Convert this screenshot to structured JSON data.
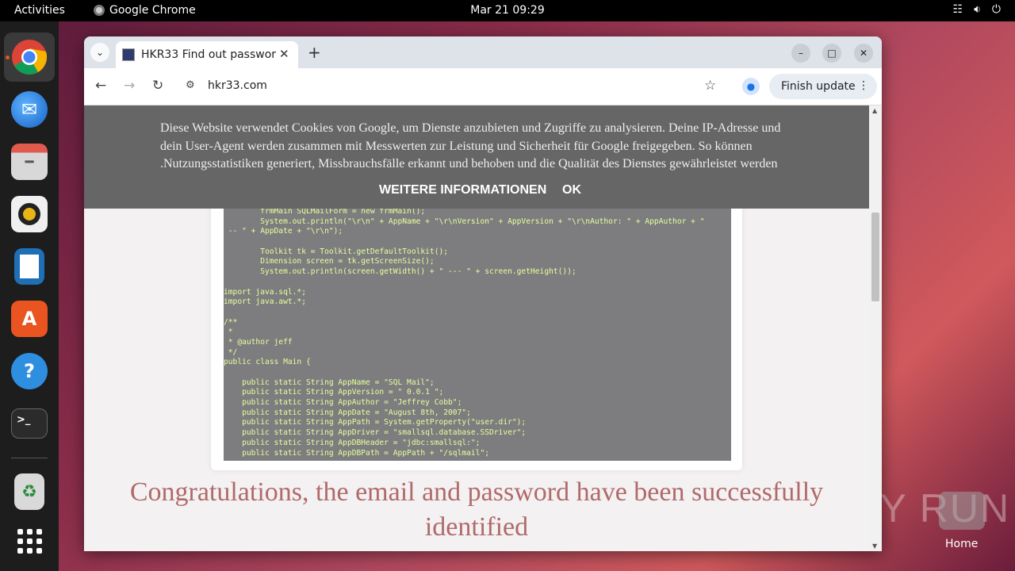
{
  "topbar": {
    "activities": "Activities",
    "app_name": "Google Chrome",
    "clock": "Mar 21  09:29"
  },
  "dock": {
    "items": [
      "chrome-icon",
      "thunderbird-icon",
      "files-icon",
      "rhythmbox-icon",
      "writer-icon",
      "app-center-icon",
      "help-icon",
      "terminal-icon",
      "trash-icon",
      "apps-grid-icon"
    ]
  },
  "browser": {
    "tab_title": "HKR33 Find out passwor",
    "url": "hkr33.com",
    "update_label": "Finish update"
  },
  "cookie_banner": {
    "message": "Diese Website verwendet Cookies von Google, um Dienste anzubieten und Zugriffe zu analysieren. Deine IP-Adresse und dein User-Agent werden zusammen mit Messwerten zur Leistung und Sicherheit für Google freigegeben. So können .Nutzungsstatistiken generiert, Missbrauchsfälle erkannt und behoben und die Qualität des Dienstes gewährleistet werden",
    "more_label": "WEITERE INFORMATIONEN",
    "ok_label": "OK"
  },
  "code_lines": [
    "        frmMain SQLMailForm = new frmMain();",
    "        System.out.println(\"\\r\\n\" + AppName + \"\\r\\nVersion\" + AppVersion + \"\\r\\nAuthor: \" + AppAuthor + \"",
    " -- \" + AppDate + \"\\r\\n\");",
    "",
    "        Toolkit tk = Toolkit.getDefaultToolkit();",
    "        Dimension screen = tk.getScreenSize();",
    "        System.out.println(screen.getWidth() + \" --- \" + screen.getHeight());",
    "",
    "import java.sql.*;",
    "import java.awt.*;",
    "",
    "/**",
    " *",
    " * @author jeff",
    " */",
    "public class Main {",
    "",
    "    public static String AppName = \"SQL Mail\";",
    "    public static String AppVersion = \" 0.0.1 \";",
    "    public static String AppAuthor = \"Jeffrey Cobb\";",
    "    public static String AppDate = \"August 8th, 2007\";",
    "    public static String AppPath = System.getProperty(\"user.dir\");",
    "    public static String AppDriver = \"smallsql.database.SSDriver\";",
    "    public static String AppDBHeader = \"jdbc:smallsql:\";",
    "    public static String AppDBPath = AppPath + \"/sqlmail\";"
  ],
  "congrats": "Congratulations, the email and password have been successfully identified",
  "watermark": "ANY RUN",
  "home_label": "Home"
}
